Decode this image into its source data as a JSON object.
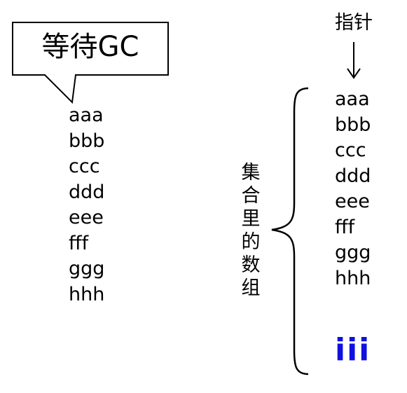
{
  "callout": {
    "label": "等待GC"
  },
  "old_array": {
    "items": [
      "aaa",
      "bbb",
      "ccc",
      "ddd",
      "eee",
      "fff",
      "ggg",
      "hhh"
    ]
  },
  "pointer": {
    "label": "指针"
  },
  "collection": {
    "label": "集合里的数组",
    "items": [
      "aaa",
      "bbb",
      "ccc",
      "ddd",
      "eee",
      "fff",
      "ggg",
      "hhh"
    ],
    "new_item": "iii"
  },
  "colors": {
    "text": "#000000",
    "new_item": "#1010e0",
    "background": "#ffffff"
  }
}
